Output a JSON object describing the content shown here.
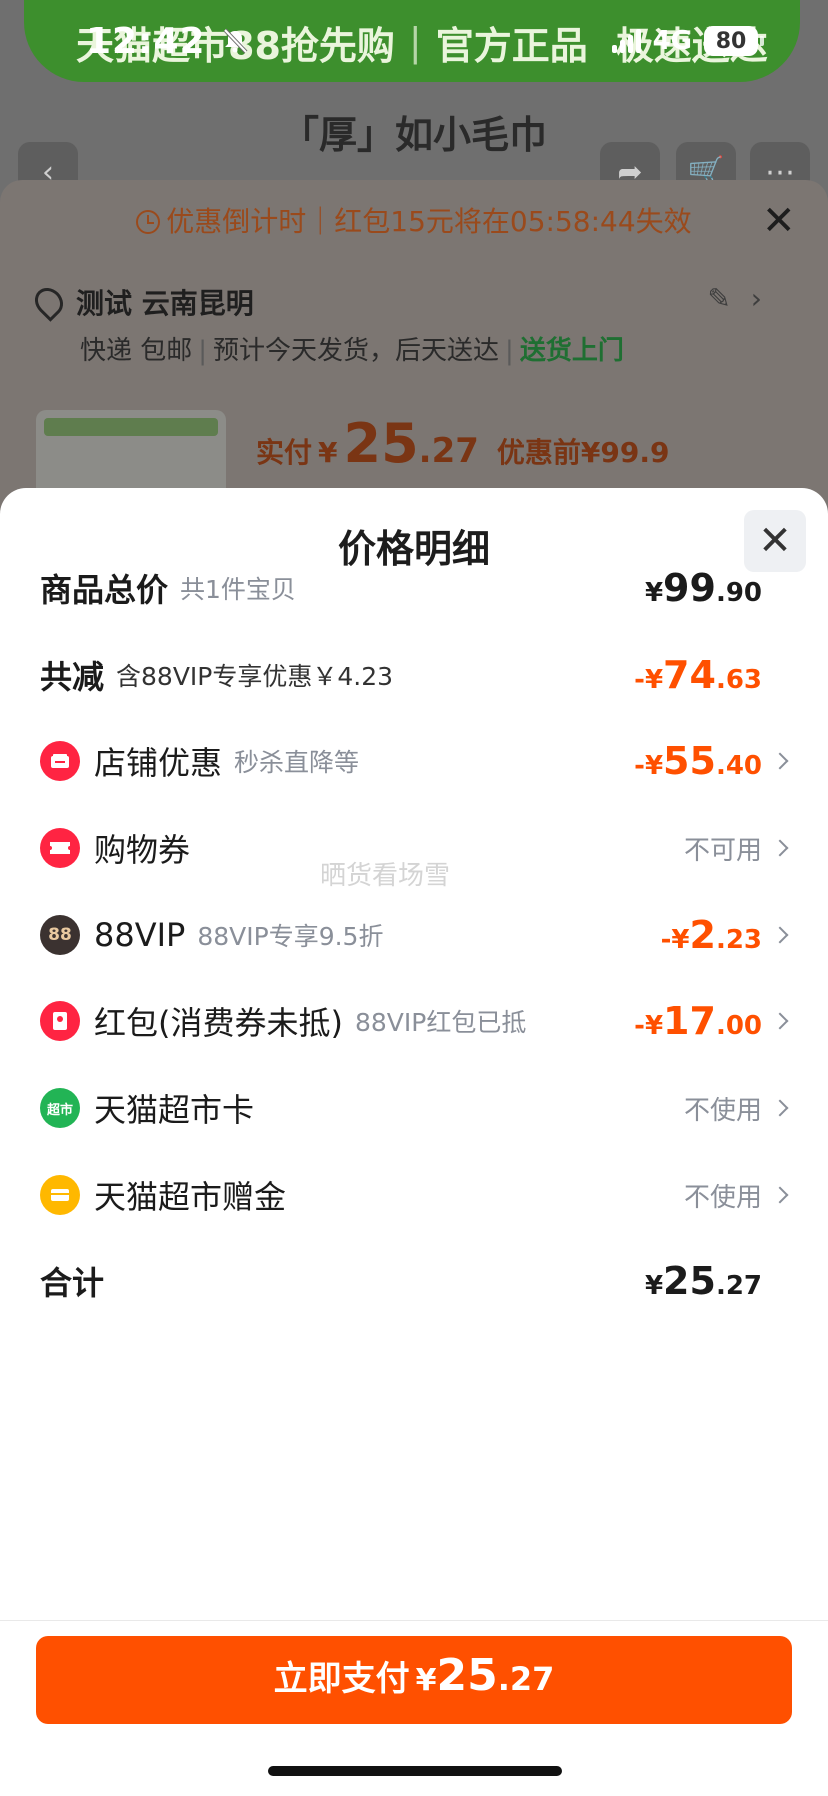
{
  "status_bar": {
    "time": "12:42",
    "network": "4G",
    "battery": "80"
  },
  "background": {
    "banner_text": "天猫超市88抢先购",
    "banner_text2": "官方正品",
    "banner_text3": "极速送达",
    "page_title": "「厚」如小毛巾",
    "countdown": "优惠倒计时｜红包15元将在05:58:44失效",
    "address": "测试 云南昆明",
    "shipping_1": "快递 包邮",
    "shipping_2": "预计今天发货，后天送达",
    "shipping_3": "送货上门",
    "pay_label": "实付",
    "pay_currency": "¥",
    "pay_int": "25",
    "pay_dec": ".27",
    "pre_price": "优惠前¥99.9"
  },
  "modal": {
    "title": "价格明细",
    "rows": [
      {
        "label": "商品总价",
        "sub": "共1件宝贝",
        "amount_cur": "¥",
        "amount_int": "99",
        "amount_dec": ".90"
      },
      {
        "label": "共减",
        "sub": "含88VIP专享优惠￥4.23",
        "amount_cur": "-¥",
        "amount_int": "74",
        "amount_dec": ".63"
      },
      {
        "label": "店铺优惠",
        "sub": "秒杀直降等",
        "amount_cur": "-¥",
        "amount_int": "55",
        "amount_dec": ".40"
      },
      {
        "label": "购物券",
        "value": "不可用"
      },
      {
        "label": "88VIP",
        "sub": "88VIP专享9.5折",
        "amount_cur": "-¥",
        "amount_int": "2",
        "amount_dec": ".23",
        "icon_text": "88"
      },
      {
        "label": "红包(消费券未抵)",
        "sub": "88VIP红包已抵",
        "amount_cur": "-¥",
        "amount_int": "17",
        "amount_dec": ".00"
      },
      {
        "label": "天猫超市卡",
        "value": "不使用",
        "icon_text": "超市"
      },
      {
        "label": "天猫超市赠金",
        "value": "不使用"
      },
      {
        "label": "合计",
        "amount_cur": "¥",
        "amount_int": "25",
        "amount_dec": ".27"
      }
    ],
    "watermark": "晒货看场雪"
  },
  "pay_button": {
    "label": "立即支付",
    "currency": "¥",
    "int": "25",
    "dec": ".27"
  },
  "colors": {
    "accent": "#ff5000",
    "text": "#1b1b1b",
    "muted": "#8a8f99"
  }
}
